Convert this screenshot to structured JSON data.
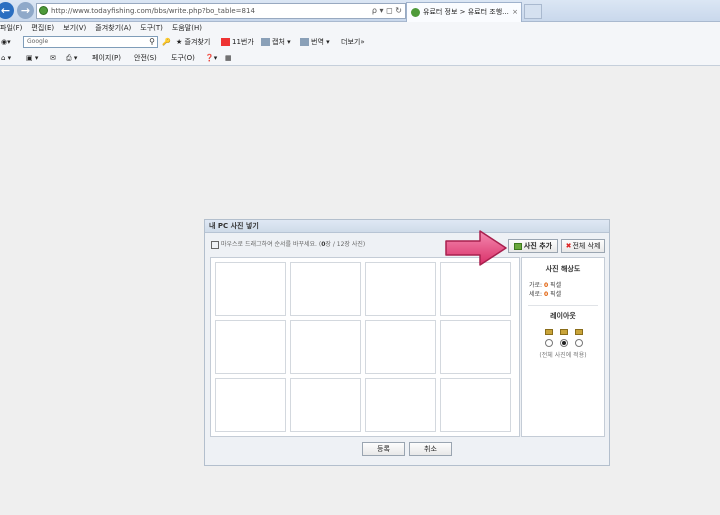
{
  "browser": {
    "url": "http://www.todayfishing.com/bbs/write.php?bo_table=814",
    "tab_title": "유료터 정보 > 유료터 조행...",
    "tab_close": "×",
    "addr_controls": "ρ ▾ ◻ ↻"
  },
  "menu": {
    "items": [
      "파일(F)",
      "편집(E)",
      "보기(V)",
      "즐겨찾기(A)",
      "도구(T)",
      "도움말(H)"
    ]
  },
  "favorites_bar": {
    "search_placeholder": "Google",
    "search_icon": "magnifier-icon",
    "items": [
      "즐겨찾기",
      "11번가",
      "캡처",
      "번역",
      "더보기"
    ],
    "more_symbol": "»"
  },
  "command_bar": {
    "items": [
      "페이지(P)",
      "안전(S)",
      "도구(O)"
    ]
  },
  "dialog": {
    "title": "내 PC 사진 넣기",
    "hint": "마우스로 드래그하여 순서를 바꾸세요.",
    "count_prefix": "(",
    "count_current": "0",
    "count_suffix": "장 / 12장 사진)",
    "add_button": "사진 추가",
    "delete_all_button": "전체 삭제",
    "delete_symbol": "✖",
    "photo_slots": 12,
    "resolution": {
      "title": "사진 해상도",
      "width_label": "가로:",
      "width_value": "0",
      "height_label": "세로:",
      "height_value": "0",
      "unit": "픽셀"
    },
    "layout": {
      "title": "레이아웃",
      "options": [
        "layout-1",
        "layout-2",
        "layout-3"
      ],
      "selected_index": 1,
      "note": "(전체 사진에 적용)"
    },
    "register_button": "등록",
    "cancel_button": "취소"
  },
  "colors": {
    "accent_orange": "#e05a00",
    "arrow_pink": "#e8447a",
    "ie_blue": "#2b6fc1"
  }
}
